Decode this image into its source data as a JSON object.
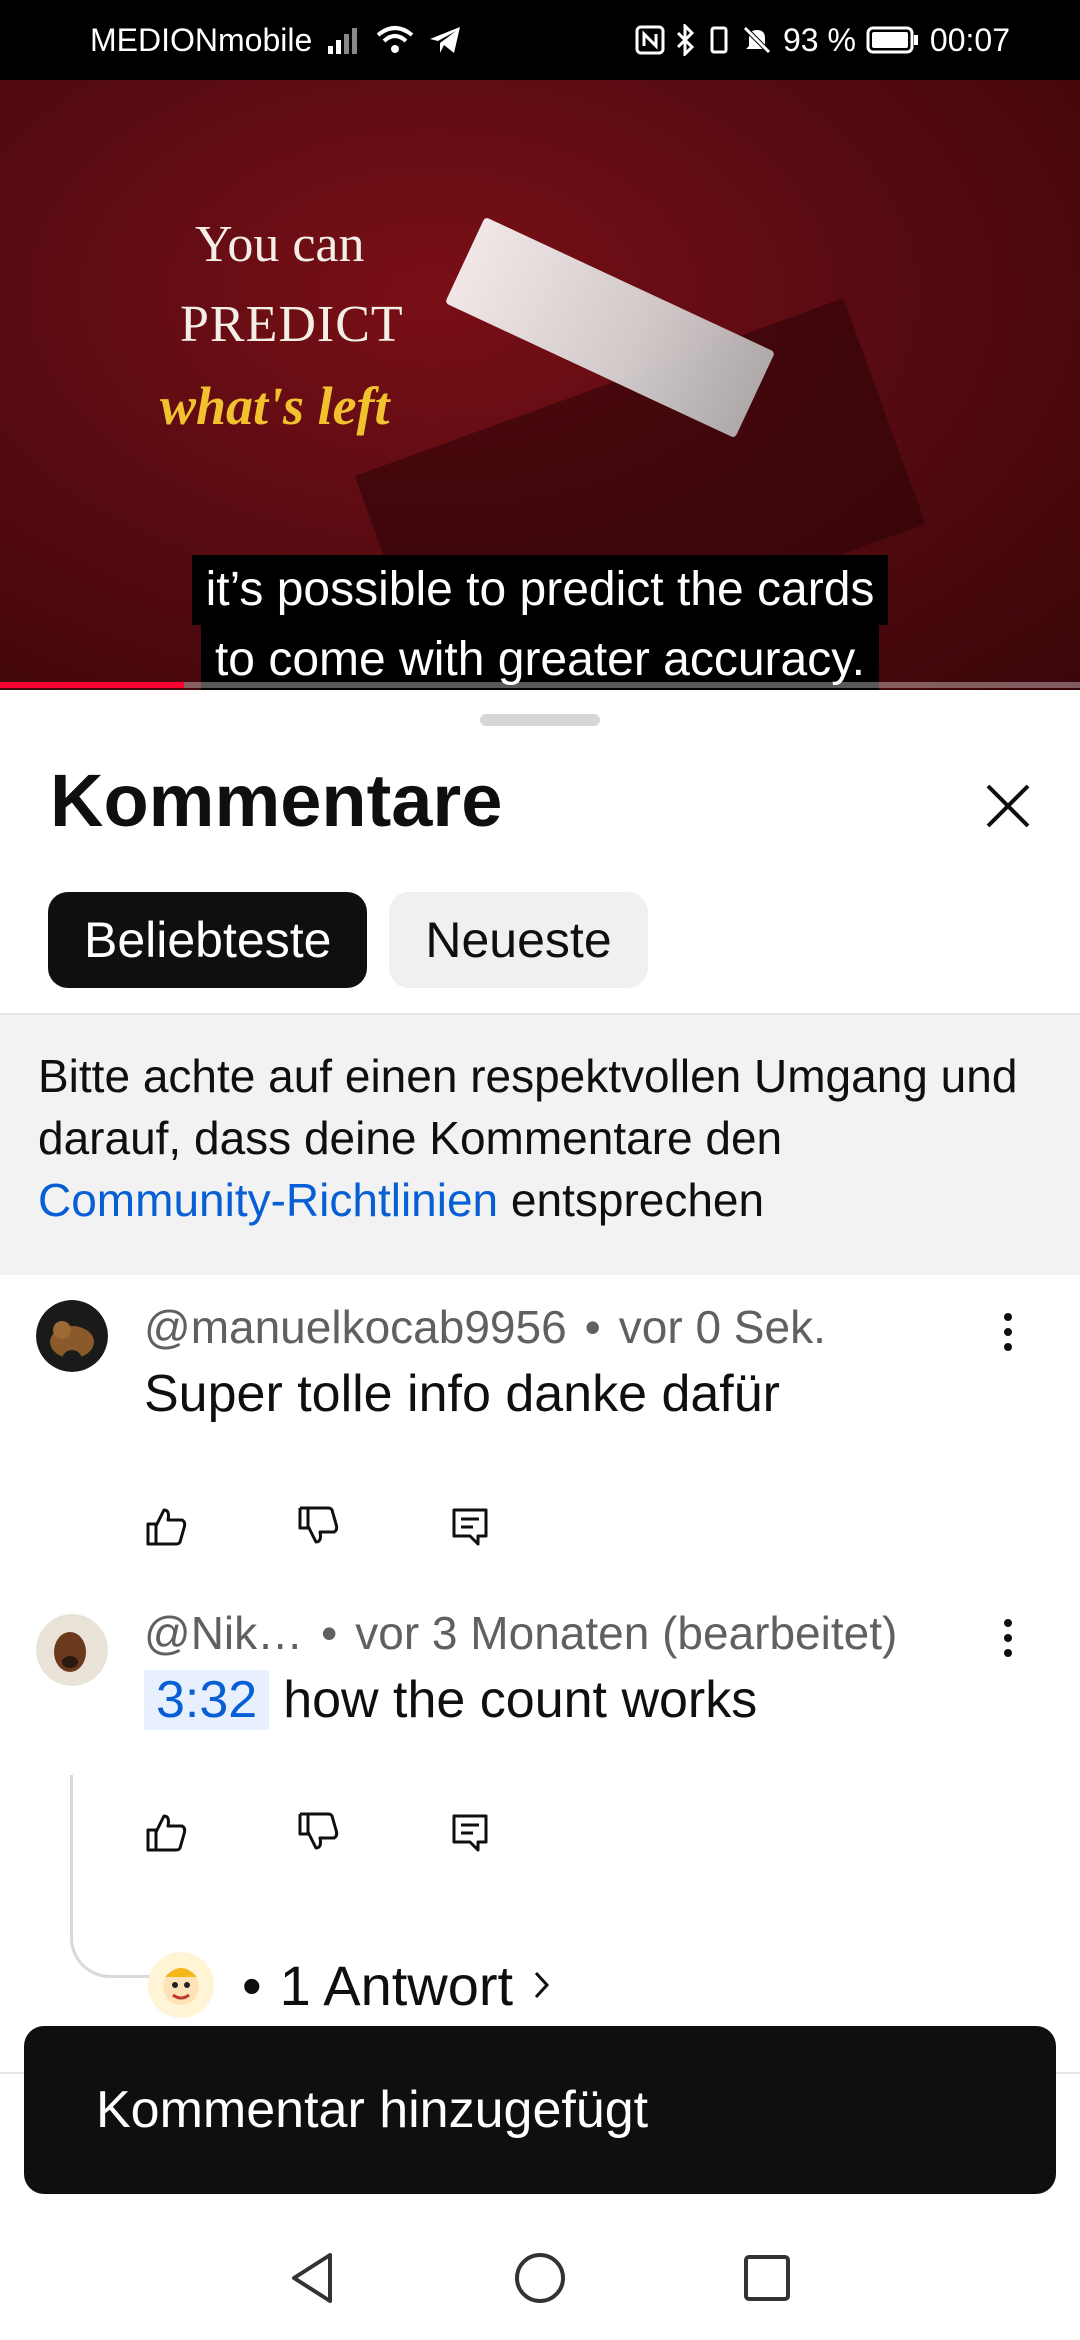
{
  "status_bar": {
    "carrier": "MEDIONmobile",
    "battery": "93 %",
    "time": "00:07"
  },
  "video": {
    "overlay_lines": [
      "You can",
      "PREDICT",
      "what's left"
    ],
    "caption_lines": [
      "it’s possible to predict the cards",
      "to come with greater accuracy."
    ],
    "progress": 0.17
  },
  "comments_sheet": {
    "title": "Kommentare",
    "sort_chips": [
      "Beliebteste",
      "Neueste"
    ],
    "notice": {
      "text_before": "Bitte achte auf einen respektvollen Umgang und darauf, dass deine Kommentare den ",
      "link": "Community-Richtlinien",
      "text_after": " entsprechen"
    },
    "comments": [
      {
        "author": "@manuelkocab9956",
        "time": "vor 0 Sek.",
        "text": "Super tolle info danke dafür"
      },
      {
        "author": "@Nik…",
        "time": "vor 3 Monaten (bearbeitet)",
        "timestamp": "3:32",
        "text": "how the count works",
        "replies": "1 Antwort"
      }
    ]
  },
  "toast": "Kommentar hinzugefügt",
  "icons": {
    "close": "close-icon",
    "like": "thumbs-up-icon",
    "dislike": "thumbs-down-icon",
    "reply": "reply-icon",
    "more": "more-vert-icon"
  }
}
